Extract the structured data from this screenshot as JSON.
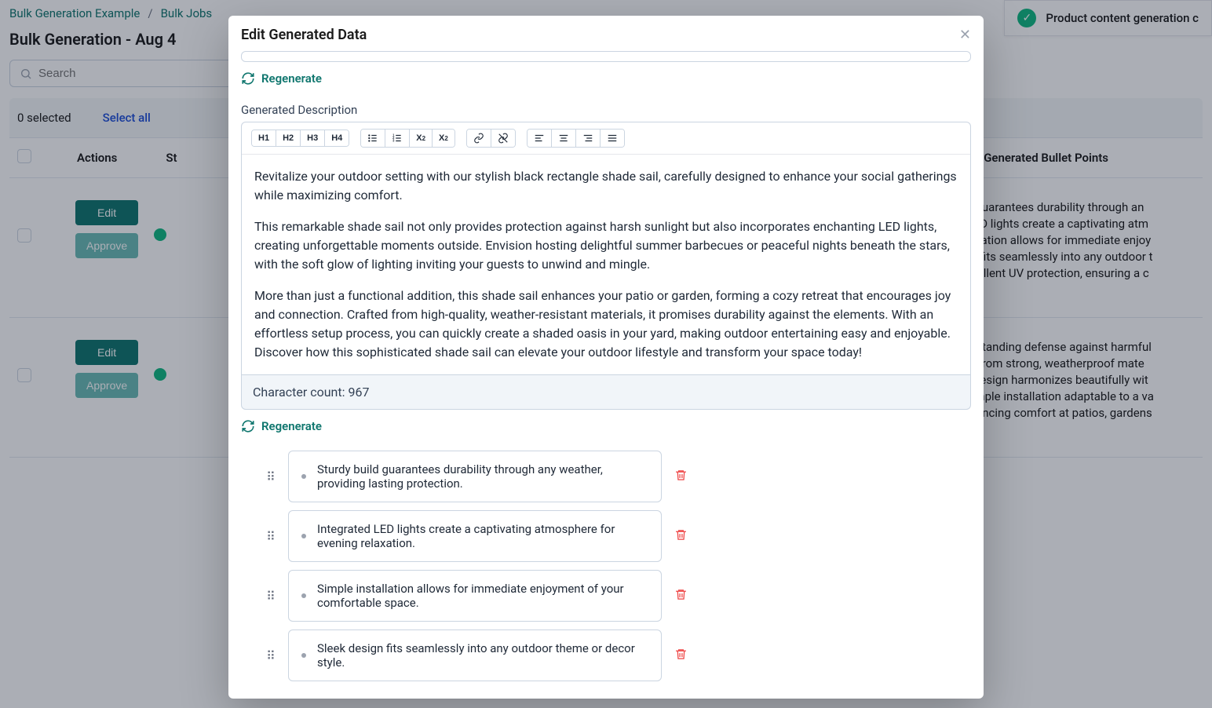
{
  "breadcrumb": [
    "Bulk Generation Example",
    "Bulk Jobs"
  ],
  "page_title": "Bulk Generation - Aug 4",
  "search_placeholder": "Search",
  "selectbar": {
    "count_label": "0 selected",
    "select_all": "Select all"
  },
  "table": {
    "headers": {
      "actions": "Actions",
      "status": "St",
      "bullets": "Generated Bullet Points"
    },
    "rows": [
      {
        "edit": "Edit",
        "approve": "Approve",
        "bullets": [
          "Sturdy build guarantees durability through an",
          "Integrated LED lights create a captivating atm",
          "Simple installation allows for immediate enjoy",
          "Sleek design fits seamlessly into any outdoor t",
          "Provides excellent UV protection, ensuring a c"
        ]
      },
      {
        "edit": "Edit",
        "approve": "Approve",
        "bullets": [
          "Provides outstanding defense against harmful",
          "Constructed from strong, weatherproof mate",
          "Sleek beige design harmonizes beautifully wit",
          "Quick and simple installation adaptable to a va",
          "Ideal for enhancing comfort at patios, gardens"
        ]
      }
    ]
  },
  "toast": "Product content generation c",
  "modal": {
    "title": "Edit Generated Data",
    "regenerate": "Regenerate",
    "section_label": "Generated Description",
    "toolbar": {
      "headings": [
        "H1",
        "H2",
        "H3",
        "H4"
      ]
    },
    "paragraphs": [
      "Revitalize your outdoor setting with our stylish black rectangle shade sail, carefully designed to enhance your social gatherings while maximizing comfort.",
      "This remarkable shade sail not only provides protection against harsh sunlight but also incorporates enchanting LED lights, creating unforgettable moments outside. Envision hosting delightful summer barbecues or peaceful nights beneath the stars, with the soft glow of lighting inviting your guests to unwind and mingle.",
      "More than just a functional addition, this shade sail enhances your patio or garden, forming a cozy retreat that encourages joy and connection. Crafted from high-quality, weather-resistant materials, it promises durability against the elements. With an effortless setup process, you can quickly create a shaded oasis in your yard, making outdoor entertaining easy and enjoyable. Discover how this sophisticated shade sail can elevate your outdoor lifestyle and transform your space today!"
    ],
    "char_count_label": "Character count: 967",
    "bullets": [
      "Sturdy build guarantees durability through any weather, providing lasting protection.",
      "Integrated LED lights create a captivating atmosphere for evening relaxation.",
      "Simple installation allows for immediate enjoyment of your comfortable space.",
      "Sleek design fits seamlessly into any outdoor theme or decor style."
    ]
  }
}
